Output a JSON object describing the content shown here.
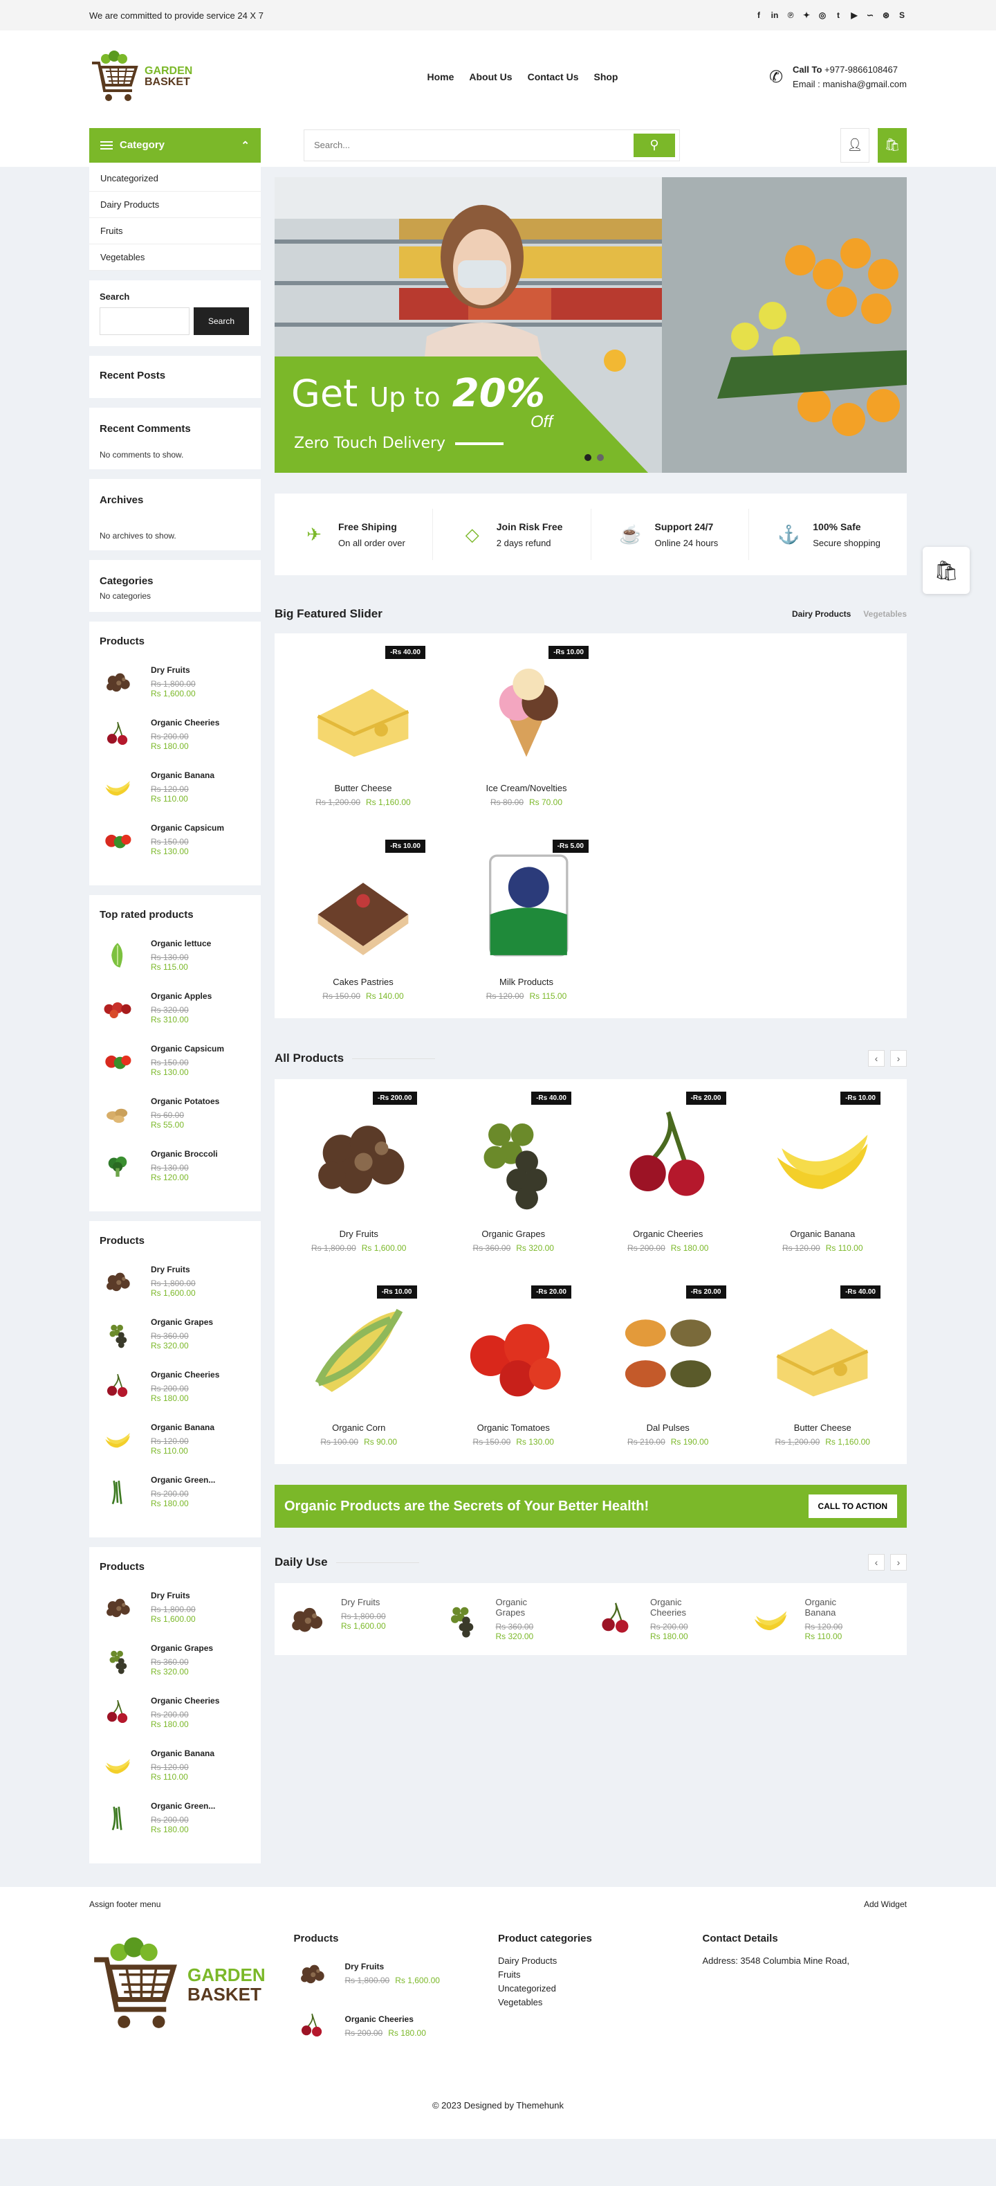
{
  "topbar": {
    "text": "We are committed to provide service 24 X 7",
    "social_icons": [
      "facebook-icon",
      "linkedin-icon",
      "pinterest-icon",
      "twitter-icon",
      "instagram-icon",
      "tumblr-icon",
      "youtube-icon",
      "stumbleupon-icon",
      "dribbble-icon",
      "skype-icon"
    ]
  },
  "header": {
    "logo_top": "GARDEN",
    "logo_bottom": "BASKET",
    "nav": [
      "Home",
      "About Us",
      "Contact Us",
      "Shop"
    ],
    "call_label": "Call To",
    "phone": "+977-9866108467",
    "email_label": "Email :",
    "email": "manisha@gmail.com",
    "category_label": "Category",
    "search_placeholder": "Search..."
  },
  "sidebar": {
    "categories": [
      "Uncategorized",
      "Dairy Products",
      "Fruits",
      "Vegetables"
    ],
    "search_title": "Search",
    "search_button": "Search",
    "recent_posts": "Recent Posts",
    "recent_comments": "Recent Comments",
    "no_comments": "No comments to show.",
    "archives": "Archives",
    "no_archives": "No archives to show.",
    "categories_title": "Categories",
    "no_categories": "No categories",
    "products_title": "Products",
    "top_rated_title": "Top rated products",
    "products1": [
      {
        "name": "Dry Fruits",
        "old": "Rs 1,800.00",
        "new": "Rs 1,600.00",
        "icon": "dry-fruits"
      },
      {
        "name": "Organic Cheeries",
        "old": "Rs 200.00",
        "new": "Rs 180.00",
        "icon": "cherries"
      },
      {
        "name": "Organic Banana",
        "old": "Rs 120.00",
        "new": "Rs 110.00",
        "icon": "banana"
      },
      {
        "name": "Organic Capsicum",
        "old": "Rs 150.00",
        "new": "Rs 130.00",
        "icon": "capsicum"
      }
    ],
    "top_rated": [
      {
        "name": "Organic lettuce",
        "old": "Rs 130.00",
        "new": "Rs 115.00",
        "icon": "lettuce"
      },
      {
        "name": "Organic Apples",
        "old": "Rs 320.00",
        "new": "Rs 310.00",
        "icon": "apples"
      },
      {
        "name": "Organic Capsicum",
        "old": "Rs 150.00",
        "new": "Rs 130.00",
        "icon": "capsicum"
      },
      {
        "name": "Organic Potatoes",
        "old": "Rs 60.00",
        "new": "Rs 55.00",
        "icon": "potatoes"
      },
      {
        "name": "Organic Broccoli",
        "old": "Rs 130.00",
        "new": "Rs 120.00",
        "icon": "broccoli"
      }
    ],
    "products2": [
      {
        "name": "Dry Fruits",
        "old": "Rs 1,800.00",
        "new": "Rs 1,600.00",
        "icon": "dry-fruits"
      },
      {
        "name": "Organic Grapes",
        "old": "Rs 360.00",
        "new": "Rs 320.00",
        "icon": "grapes"
      },
      {
        "name": "Organic Cheeries",
        "old": "Rs 200.00",
        "new": "Rs 180.00",
        "icon": "cherries"
      },
      {
        "name": "Organic Banana",
        "old": "Rs 120.00",
        "new": "Rs 110.00",
        "icon": "banana"
      },
      {
        "name": "Organic Green...",
        "old": "Rs 200.00",
        "new": "Rs 180.00",
        "icon": "beans"
      }
    ]
  },
  "hero": {
    "get": "Get",
    "up_to": "Up to",
    "percent": "20%",
    "off": "Off",
    "delivery": "Zero Touch Delivery"
  },
  "features": [
    {
      "title": "Free Shiping",
      "sub": "On all order over",
      "icon": "plane-icon"
    },
    {
      "title": "Join Risk Free",
      "sub": "2 days refund",
      "icon": "diamond-icon"
    },
    {
      "title": "Support 24/7",
      "sub": "Online 24 hours",
      "icon": "cup-icon"
    },
    {
      "title": "100% Safe",
      "sub": "Secure shopping",
      "icon": "anchor-icon"
    }
  ],
  "featured": {
    "title": "Big Featured Slider",
    "tab_active": "Dairy Products",
    "tab_inactive": "Vegetables",
    "items": [
      {
        "badge": "-Rs 40.00",
        "name": "Butter Cheese",
        "old": "Rs 1,200.00",
        "new": "Rs 1,160.00",
        "icon": "cheese"
      },
      {
        "badge": "-Rs 10.00",
        "name": "Ice Cream/Novelties",
        "old": "Rs 80.00",
        "new": "Rs 70.00",
        "icon": "icecream"
      },
      {
        "badge": "-Rs 10.00",
        "name": "Cakes Pastries",
        "old": "Rs 150.00",
        "new": "Rs 140.00",
        "icon": "cake"
      },
      {
        "badge": "-Rs 5.00",
        "name": "Milk Products",
        "old": "Rs 120.00",
        "new": "Rs 115.00",
        "icon": "milk"
      }
    ]
  },
  "all_products": {
    "title": "All Products",
    "items": [
      {
        "badge": "-Rs 200.00",
        "name": "Dry Fruits",
        "old": "Rs 1,800.00",
        "new": "Rs 1,600.00",
        "icon": "dry-fruits"
      },
      {
        "badge": "-Rs 40.00",
        "name": "Organic Grapes",
        "old": "Rs 360.00",
        "new": "Rs 320.00",
        "icon": "grapes"
      },
      {
        "badge": "-Rs 20.00",
        "name": "Organic Cheeries",
        "old": "Rs 200.00",
        "new": "Rs 180.00",
        "icon": "cherries"
      },
      {
        "badge": "-Rs 10.00",
        "name": "Organic Banana",
        "old": "Rs 120.00",
        "new": "Rs 110.00",
        "icon": "banana"
      },
      {
        "badge": "-Rs 10.00",
        "name": "Organic Corn",
        "old": "Rs 100.00",
        "new": "Rs 90.00",
        "icon": "corn"
      },
      {
        "badge": "-Rs 20.00",
        "name": "Organic Tomatoes",
        "old": "Rs 150.00",
        "new": "Rs 130.00",
        "icon": "tomatoes"
      },
      {
        "badge": "-Rs 20.00",
        "name": "Dal Pulses",
        "old": "Rs 210.00",
        "new": "Rs 190.00",
        "icon": "pulses"
      },
      {
        "badge": "-Rs 40.00",
        "name": "Butter Cheese",
        "old": "Rs 1,200.00",
        "new": "Rs 1,160.00",
        "icon": "cheese"
      }
    ]
  },
  "cta": {
    "text": "Organic Products are the Secrets of Your Better Health!",
    "button": "CALL TO ACTION"
  },
  "daily": {
    "title": "Daily Use",
    "items": [
      {
        "name": "Dry Fruits",
        "old": "Rs 1,800.00",
        "new": "Rs 1,600.00",
        "icon": "dry-fruits"
      },
      {
        "name": "Organic Grapes",
        "old": "Rs 360.00",
        "new": "Rs 320.00",
        "icon": "grapes"
      },
      {
        "name": "Organic Cheeries",
        "old": "Rs 200.00",
        "new": "Rs 180.00",
        "icon": "cherries"
      },
      {
        "name": "Organic Banana",
        "old": "Rs 120.00",
        "new": "Rs 110.00",
        "icon": "banana"
      }
    ]
  },
  "footer": {
    "assign_menu": "Assign footer menu",
    "add_widget": "Add Widget",
    "products_title": "Products",
    "products": [
      {
        "name": "Dry Fruits",
        "old": "Rs 1,800.00",
        "new": "Rs 1,600.00",
        "icon": "dry-fruits"
      },
      {
        "name": "Organic Cheeries",
        "old": "Rs 200.00",
        "new": "Rs 180.00",
        "icon": "cherries"
      }
    ],
    "cats_title": "Product categories",
    "cats": [
      "Dairy Products",
      "Fruits",
      "Uncategorized",
      "Vegetables"
    ],
    "contact_title": "Contact Details",
    "address": "Address: 3548 Columbia Mine Road,",
    "copyright": "© 2023 Designed by Themehunk"
  },
  "colors": {
    "accent": "#7bb829",
    "dark": "#111111",
    "brown": "#5a3a1f"
  }
}
